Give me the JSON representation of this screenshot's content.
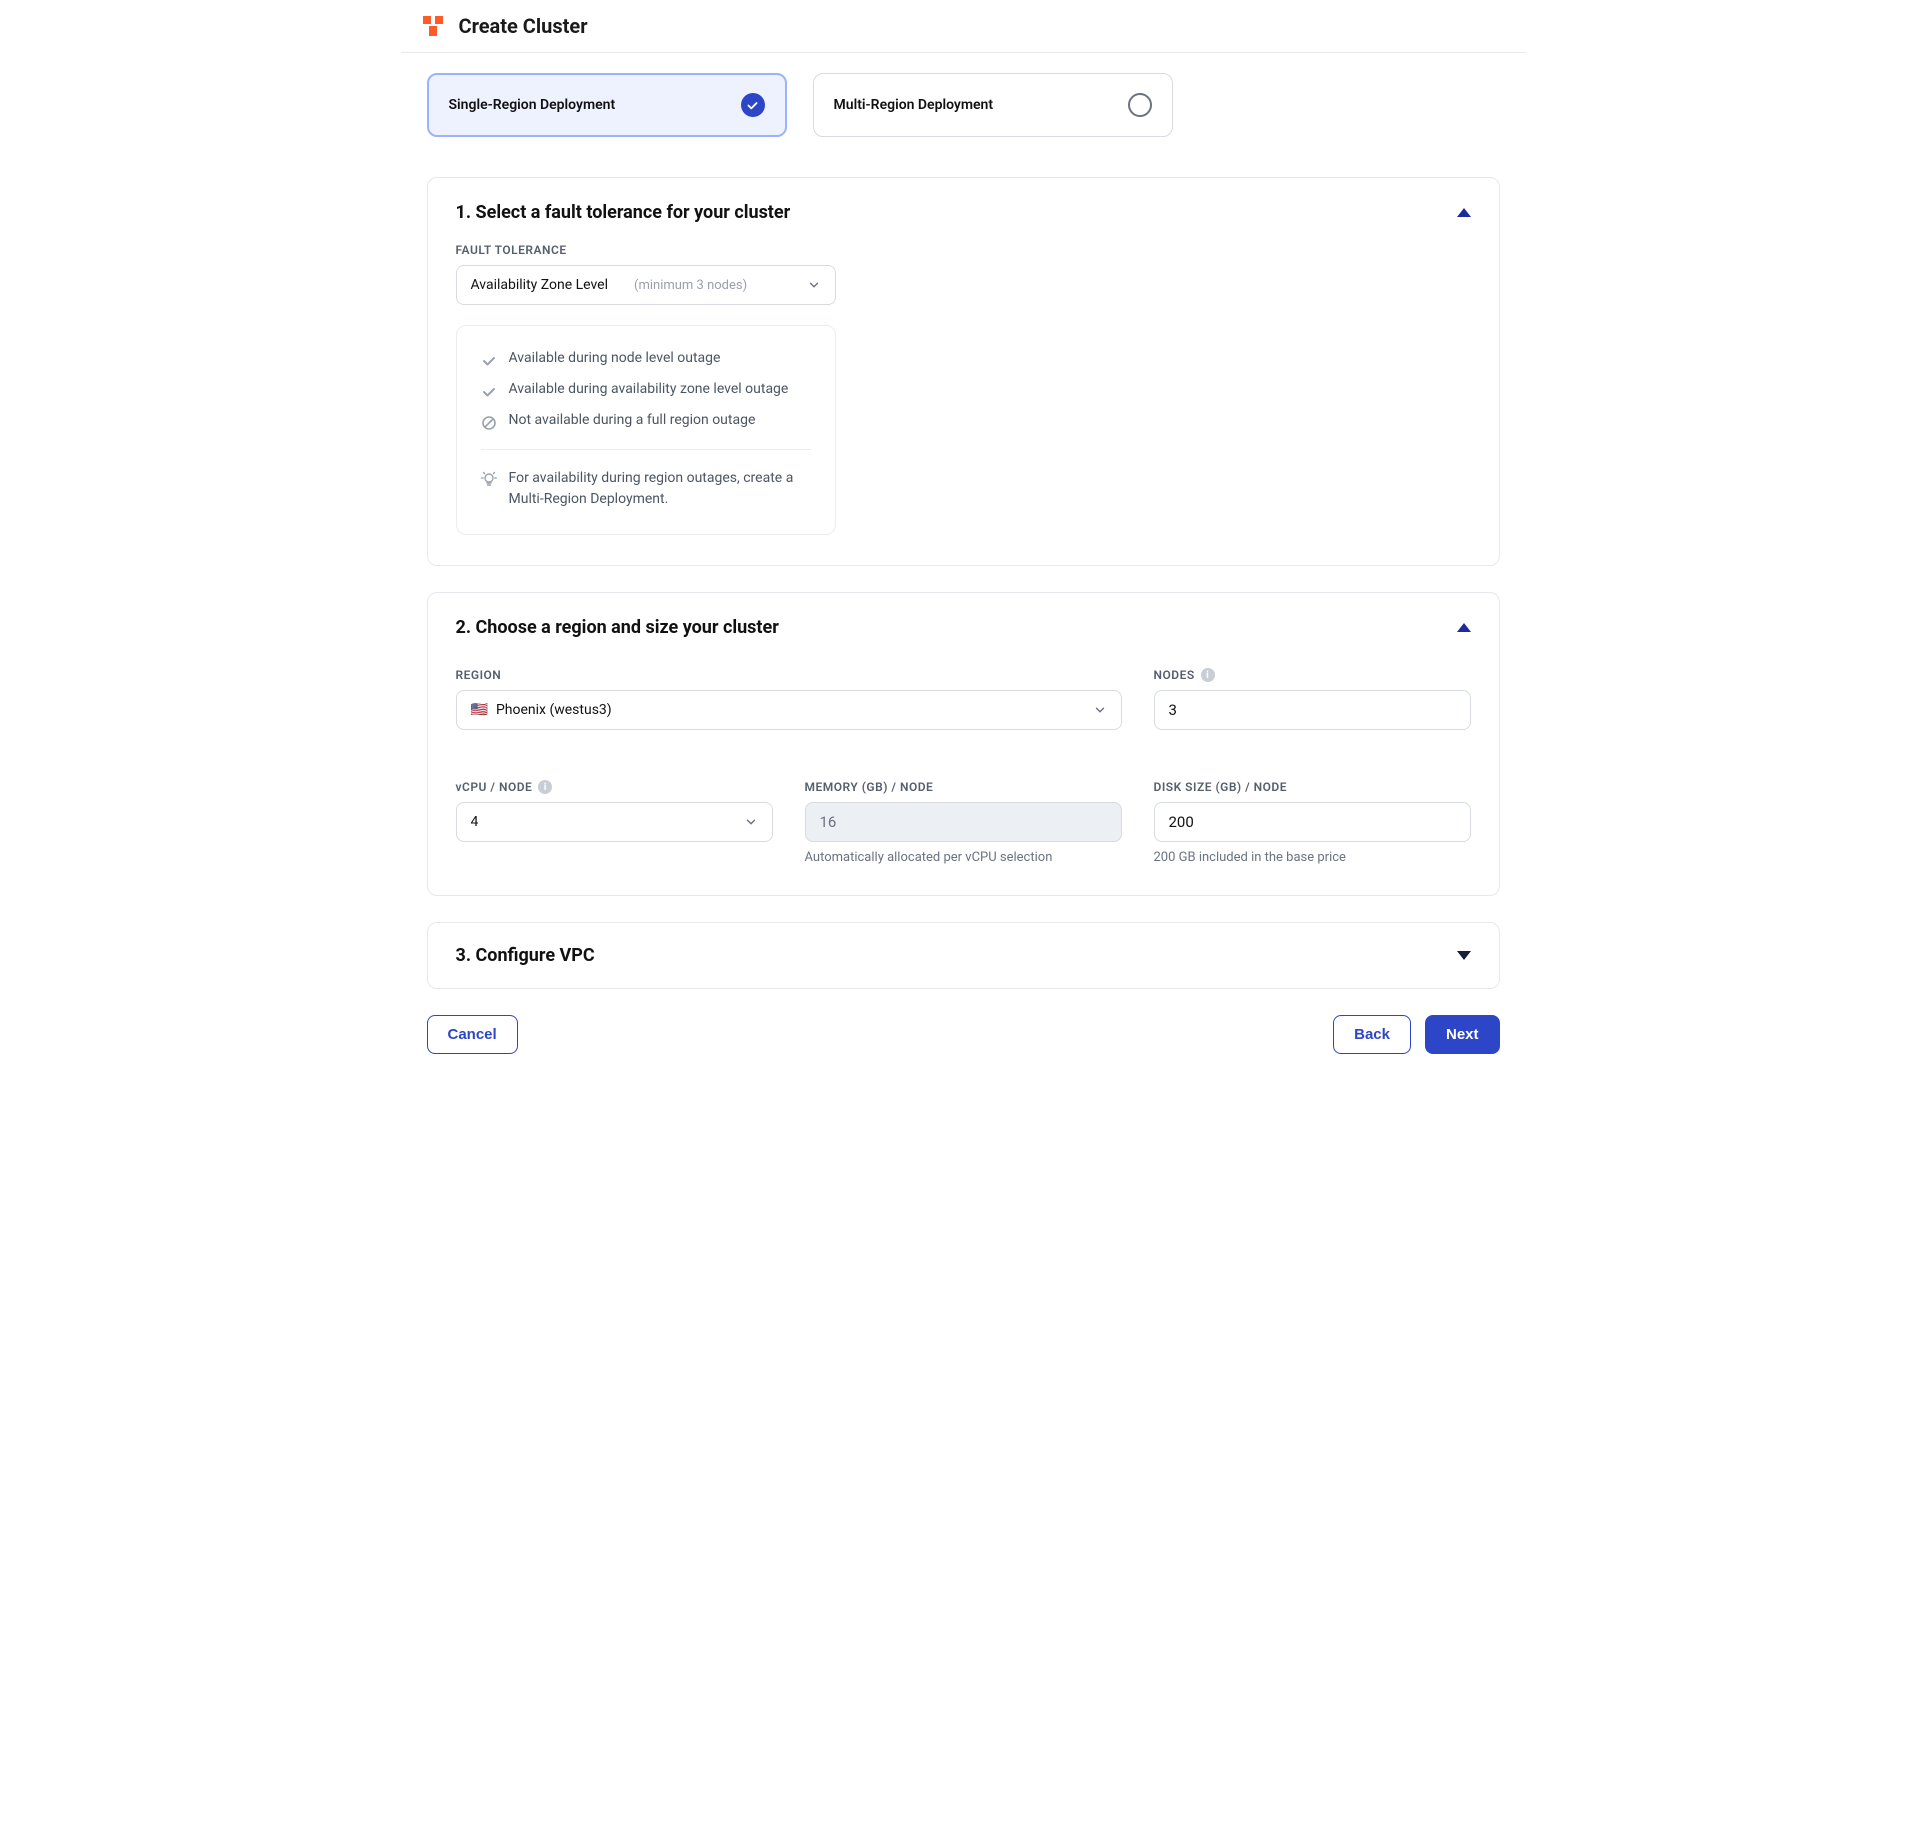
{
  "header": {
    "title": "Create Cluster"
  },
  "deployment_options": {
    "single": "Single-Region Deployment",
    "multi": "Multi-Region Deployment"
  },
  "section1": {
    "title": "1. Select a fault tolerance for your cluster",
    "ft_label": "FAULT TOLERANCE",
    "ft_value": "Availability Zone Level",
    "ft_hint": "(minimum 3 nodes)",
    "bullets": {
      "b1": "Available during node level outage",
      "b2": "Available during availability zone level outage",
      "b3": "Not available during a full region outage"
    },
    "tip": "For availability during region outages, create a Multi-Region Deployment."
  },
  "section2": {
    "title": "2. Choose a region and size your cluster",
    "region_label": "REGION",
    "region_value": "Phoenix (westus3)",
    "nodes_label": "NODES",
    "nodes_value": "3",
    "vcpu_label": "vCPU / NODE",
    "vcpu_value": "4",
    "mem_label": "MEMORY (GB) / NODE",
    "mem_value": "16",
    "mem_help": "Automatically allocated per vCPU selection",
    "disk_label": "DISK SIZE (GB) / NODE",
    "disk_value": "200",
    "disk_help": "200 GB included in the base price"
  },
  "section3": {
    "title": "3. Configure VPC"
  },
  "footer": {
    "cancel": "Cancel",
    "back": "Back",
    "next": "Next"
  }
}
